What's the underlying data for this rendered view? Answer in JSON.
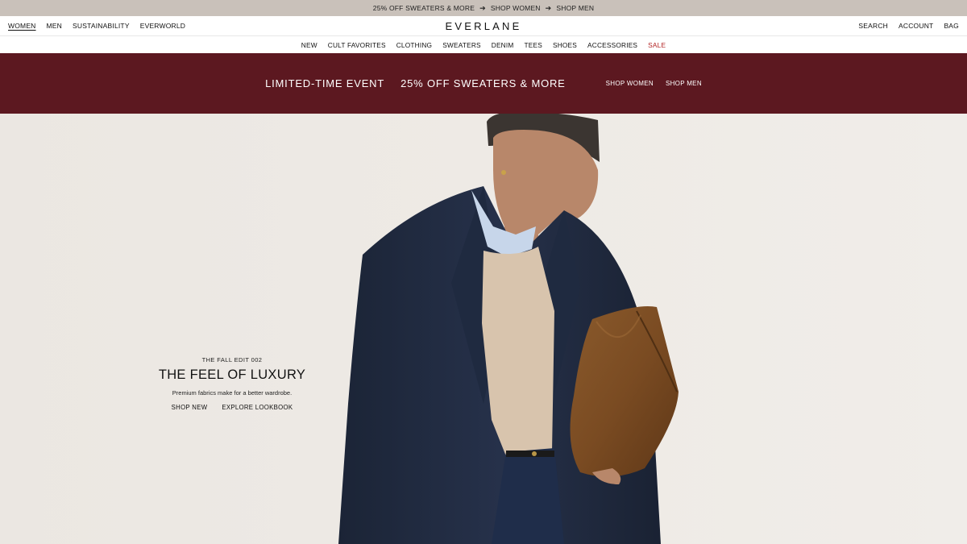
{
  "announcement": {
    "text1": "25% OFF SWEATERS & MORE",
    "arrow1": "➔",
    "link1": "SHOP WOMEN",
    "arrow2": "➔",
    "link2": "SHOP MEN"
  },
  "topnav": {
    "left": [
      "WOMEN",
      "MEN",
      "SUSTAINABILITY",
      "EVERWORLD"
    ],
    "logo": "EVERLANE",
    "right": [
      "SEARCH",
      "ACCOUNT",
      "BAG"
    ]
  },
  "categories": [
    "NEW",
    "CULT FAVORITES",
    "CLOTHING",
    "SWEATERS",
    "DENIM",
    "TEES",
    "SHOES",
    "ACCESSORIES",
    "SALE"
  ],
  "promo": {
    "title": "LIMITED-TIME EVENT",
    "offer": "25% OFF SWEATERS & MORE",
    "link_women": "SHOP WOMEN",
    "link_men": "SHOP MEN",
    "bg_color": "#5c1820"
  },
  "hero": {
    "eyebrow": "THE FALL EDIT 002",
    "headline": "THE FEEL OF LUXURY",
    "subtext": "Premium fabrics make for a better wardrobe.",
    "cta_new": "SHOP NEW",
    "cta_lookbook": "EXPLORE LOOKBOOK"
  },
  "colors": {
    "announce_bg": "#c9c1ba",
    "sale": "#b32424"
  }
}
